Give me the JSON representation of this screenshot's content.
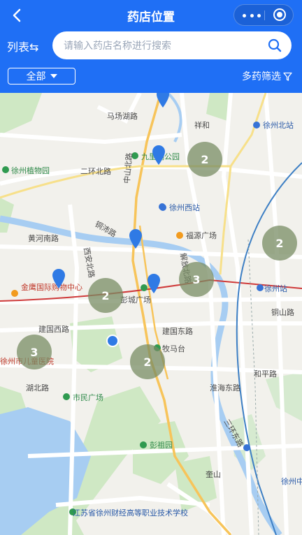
{
  "header": {
    "title": "药店位置",
    "list_toggle": "列表⇆",
    "search_placeholder": "请输入药店名称进行搜索",
    "filter_all": "全部",
    "multi_filter": "多药筛选"
  },
  "colors": {
    "header_bg": "#1f6ff5",
    "cluster": "#7f8c6a",
    "pin": "#2f7ae5"
  },
  "map": {
    "labels": {
      "l1": "马场湖路",
      "l2": "祥和",
      "l3": "徐州北站",
      "l4": "九里湖公园",
      "l5": "徐州植物园",
      "l6": "二环北路",
      "l7": "徐州西站",
      "l8": "黄河南路",
      "l9": "西安北路",
      "l10": "铜沛路",
      "l11": "福源广场",
      "l12": "金鹰国际购物中心",
      "l13": "彭城广场",
      "l14": "徐州站",
      "l15": "铜山路",
      "l16": "建国西路",
      "l17": "建国东路",
      "l18": "徐州市儿童医院",
      "l19": "淮海东路",
      "l20": "牧马台",
      "l21": "和平路",
      "l22": "湖北路",
      "l23": "市民广场",
      "l24": "彭祖园",
      "l25": "奎山",
      "l26": "江苏省徐州财经高等职业技术学校",
      "l27": "徐州中心",
      "l28": "三环东路",
      "l29": "解放北路",
      "l30": "中山北路"
    },
    "clusters": [
      {
        "id": "c1",
        "count": "2"
      },
      {
        "id": "c2",
        "count": "2"
      },
      {
        "id": "c3",
        "count": "2"
      },
      {
        "id": "c4",
        "count": "3"
      },
      {
        "id": "c5",
        "count": "3"
      },
      {
        "id": "c6",
        "count": "2"
      }
    ]
  }
}
